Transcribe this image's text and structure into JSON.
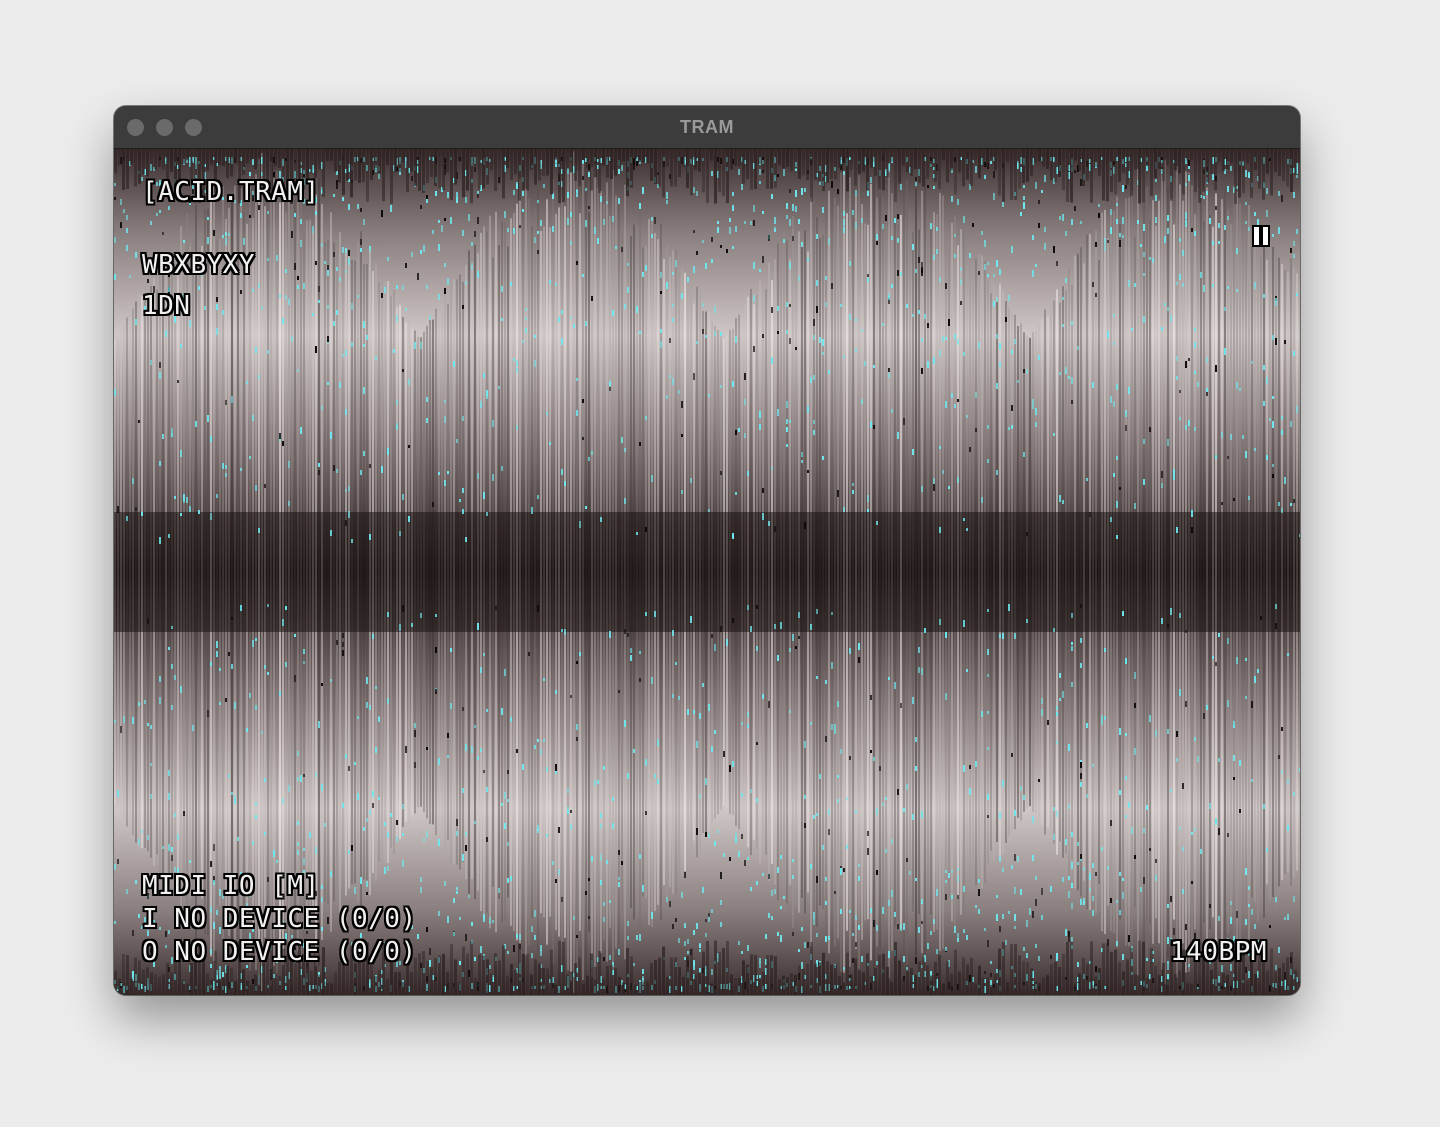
{
  "window": {
    "title": "TRAM"
  },
  "hud": {
    "app_name": "[ACID.TRAM]",
    "pattern": "WBXBYXY",
    "track": "1DN",
    "midi_header": "MIDI IO [M]",
    "midi_input": "I NO DEVICE (0/0)",
    "midi_output": "O NO DEVICE (0/0)",
    "tempo": "140BPM"
  },
  "playback": {
    "state_icon": "pause-icon"
  },
  "colors": {
    "accent_cyan": "#6ee8ee",
    "light": "#e8dedd",
    "dark": "#2a2020"
  }
}
